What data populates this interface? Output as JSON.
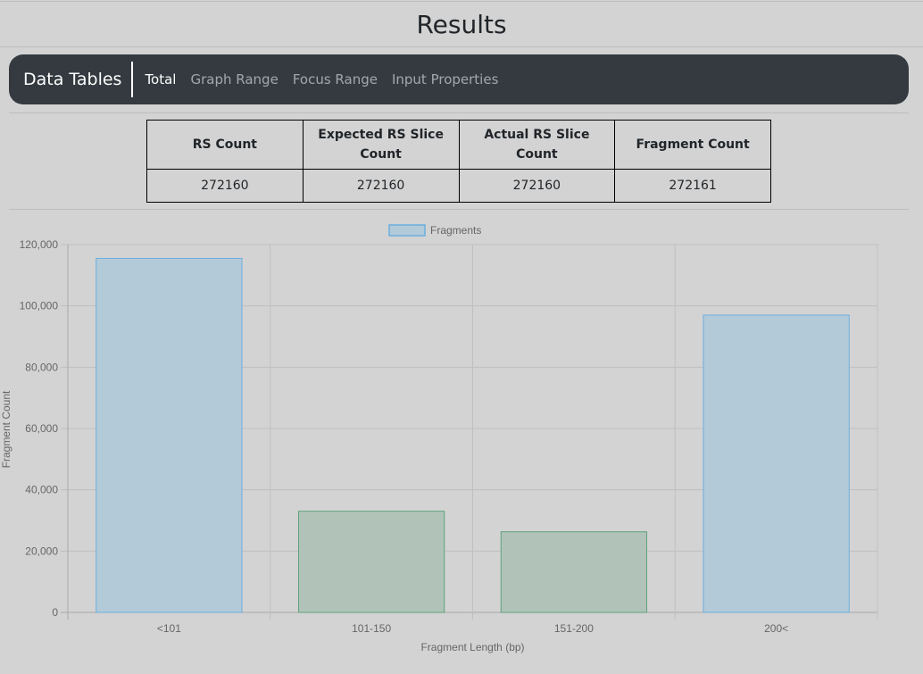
{
  "page_title": "Results",
  "navbar": {
    "brand": "Data Tables",
    "items": [
      {
        "label": "Total",
        "active": true
      },
      {
        "label": "Graph Range",
        "active": false
      },
      {
        "label": "Focus Range",
        "active": false
      },
      {
        "label": "Input Properties",
        "active": false
      }
    ]
  },
  "table": {
    "headers": [
      "RS Count",
      "Expected RS Slice Count",
      "Actual RS Slice Count",
      "Fragment Count"
    ],
    "rows": [
      [
        "272160",
        "272160",
        "272160",
        "272161"
      ]
    ]
  },
  "chart_data": {
    "type": "bar",
    "categories": [
      "<101",
      "101-150",
      "151-200",
      "200<"
    ],
    "series": [
      {
        "name": "Fragments",
        "values": [
          115500,
          33000,
          26300,
          97000
        ]
      }
    ],
    "bar_colors": [
      "#b3cad8",
      "#b1c3b8",
      "#b1c3b8",
      "#b3cad8"
    ],
    "bar_border_colors": [
      "#6aafe0",
      "#5ea37c",
      "#5ea37c",
      "#6aafe0"
    ],
    "xlabel": "Fragment Length (bp)",
    "ylabel": "Fragment Count",
    "ylim": [
      0,
      120000
    ],
    "yticks": [
      "0",
      "20,000",
      "40,000",
      "60,000",
      "80,000",
      "100,000",
      "120,000"
    ],
    "grid": true,
    "legend_position": "top"
  }
}
